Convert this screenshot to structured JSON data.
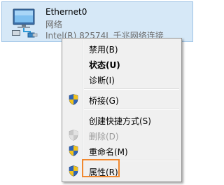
{
  "adapter": {
    "name": "Ethernet0",
    "status": "网络",
    "device": "Intel(R) 82574L 千兆网络连接",
    "icon": "network-adapter-icon"
  },
  "context_menu": {
    "items": [
      {
        "label": "禁用(B)",
        "bold": false,
        "disabled": false,
        "icon": null
      },
      {
        "label": "状态(U)",
        "bold": true,
        "disabled": false,
        "icon": null
      },
      {
        "label": "诊断(I)",
        "bold": false,
        "disabled": false,
        "icon": null
      },
      {
        "label": "桥接(G)",
        "bold": false,
        "disabled": false,
        "icon": "uac-shield-icon"
      },
      {
        "label": "创建快捷方式(S)",
        "bold": false,
        "disabled": false,
        "icon": null
      },
      {
        "label": "删除(D)",
        "bold": false,
        "disabled": true,
        "icon": "uac-shield-icon"
      },
      {
        "label": "重命名(M)",
        "bold": false,
        "disabled": false,
        "icon": "uac-shield-icon"
      },
      {
        "label": "属性(R)",
        "bold": false,
        "disabled": false,
        "icon": "uac-shield-icon"
      }
    ]
  },
  "colors": {
    "selection_bg": "#d6e8f7",
    "menu_bg": "#f0f0f0",
    "highlight_border": "#f0882f"
  }
}
